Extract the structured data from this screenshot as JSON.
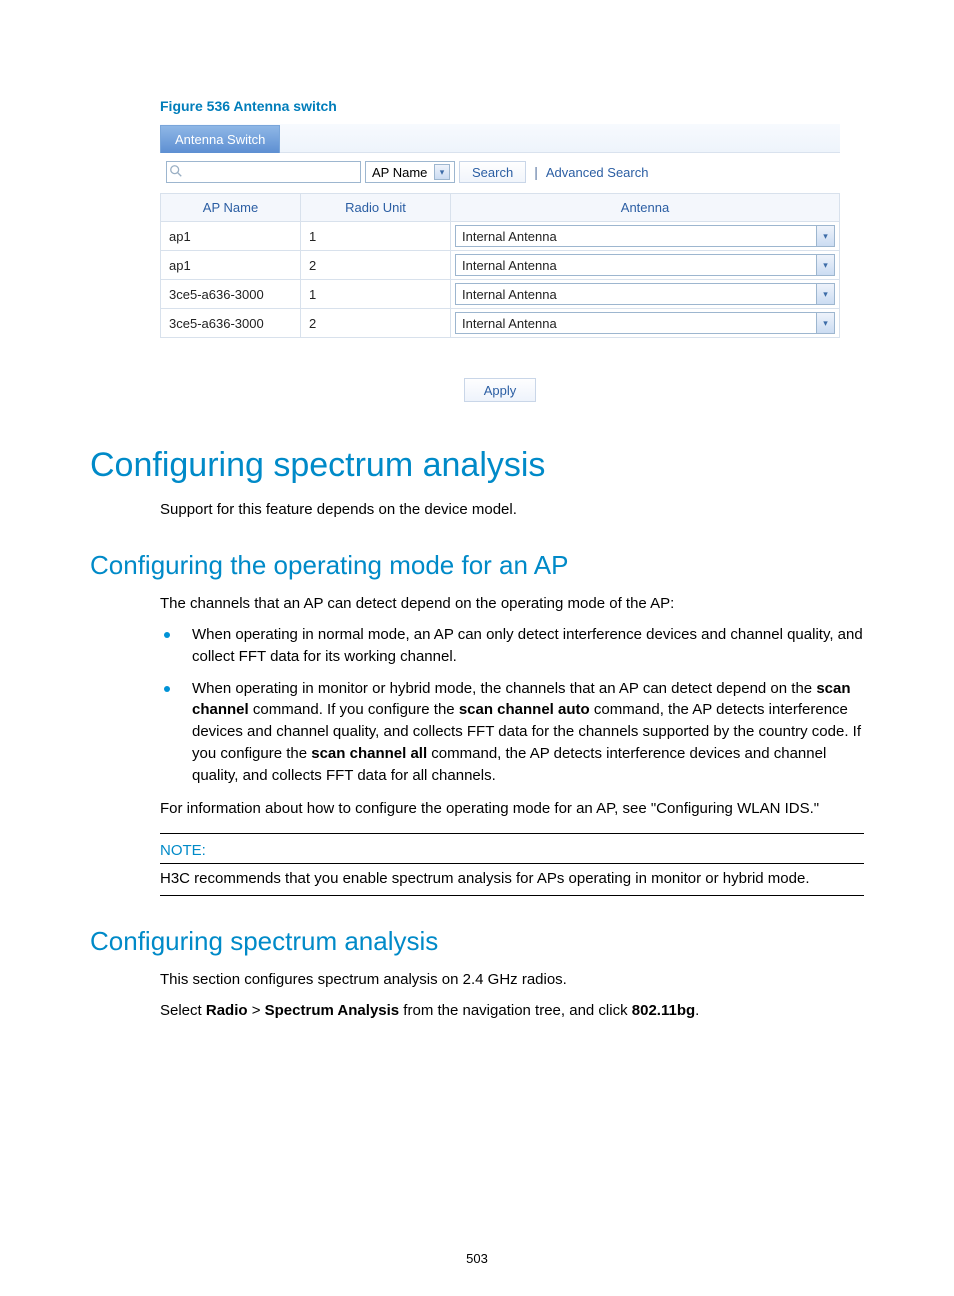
{
  "figure": {
    "caption": "Figure 536 Antenna switch"
  },
  "ui": {
    "tab_label": "Antenna Switch",
    "search": {
      "placeholder": "",
      "field_selected": "AP Name",
      "search_btn": "Search",
      "advanced": "Advanced Search"
    },
    "table": {
      "headers": {
        "ap": "AP Name",
        "radio": "Radio Unit",
        "antenna": "Antenna"
      },
      "rows": [
        {
          "ap": "ap1",
          "radio": "1",
          "antenna": "Internal Antenna"
        },
        {
          "ap": "ap1",
          "radio": "2",
          "antenna": "Internal Antenna"
        },
        {
          "ap": "3ce5-a636-3000",
          "radio": "1",
          "antenna": "Internal Antenna"
        },
        {
          "ap": "3ce5-a636-3000",
          "radio": "2",
          "antenna": "Internal Antenna"
        }
      ]
    },
    "apply": "Apply"
  },
  "headings": {
    "h1_1": "Configuring spectrum analysis",
    "p_support": "Support for this feature depends on the device model.",
    "h2_1": "Configuring the operating mode for an AP",
    "p_channels_intro": "The channels that an AP can detect depend on the operating mode of the AP:",
    "li1": "When operating in normal mode, an AP can only detect interference devices and channel quality, and collect FFT data for its working channel.",
    "li2_a": "When operating in monitor or hybrid mode, the channels that an AP can detect depend on the ",
    "li2_b1": "scan channel",
    "li2_c": " command. If you configure the ",
    "li2_b2": "scan channel auto",
    "li2_d": " command, the AP detects interference devices and channel quality, and collects FFT data for the channels supported by the country code. If you configure the ",
    "li2_b3": "scan channel all",
    "li2_e": " command, the AP detects interference devices and channel quality, and collects FFT data for all channels.",
    "p_see": "For information about how to configure the operating mode for an AP, see \"Configuring WLAN IDS.\"",
    "note_title": "NOTE:",
    "note_body": "H3C recommends that you enable spectrum analysis for APs operating in monitor or hybrid mode.",
    "h2_2": "Configuring spectrum analysis",
    "p_sect": "This section configures spectrum analysis on 2.4 GHz radios.",
    "p_nav_a": "Select ",
    "p_nav_b1": "Radio",
    "p_nav_gt": " > ",
    "p_nav_b2": "Spectrum Analysis",
    "p_nav_c": " from the navigation tree, and click ",
    "p_nav_b3": "802.11bg",
    "p_nav_d": "."
  },
  "pagenum": "503"
}
